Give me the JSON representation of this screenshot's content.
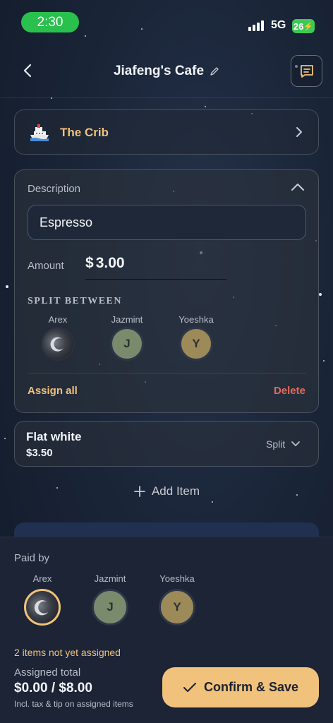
{
  "status_bar": {
    "time": "2:30",
    "network": "5G",
    "battery": "26"
  },
  "header": {
    "title": "Jiafeng's Cafe"
  },
  "group": {
    "name": "The Crib",
    "icon": "ship-icon"
  },
  "item_editor": {
    "description_label": "Description",
    "description_value": "Espresso",
    "amount_label": "Amount",
    "amount_currency": "$",
    "amount_value": "3.00",
    "split_label": "SPLIT BETWEEN",
    "members": [
      {
        "name": "Arex",
        "initial": ""
      },
      {
        "name": "Jazmint",
        "initial": "J"
      },
      {
        "name": "Yoeshka",
        "initial": "Y"
      }
    ],
    "assign_all_label": "Assign all",
    "delete_label": "Delete"
  },
  "items": [
    {
      "name": "Flat white",
      "price": "$3.50",
      "split_label": "Split"
    }
  ],
  "add_item_label": "Add Item",
  "footer": {
    "paid_by_label": "Paid by",
    "payers": [
      {
        "name": "Arex",
        "initial": "",
        "selected": true
      },
      {
        "name": "Jazmint",
        "initial": "J",
        "selected": false
      },
      {
        "name": "Yoeshka",
        "initial": "Y",
        "selected": false
      }
    ],
    "unassigned_text": "2 items not yet assigned",
    "assigned_label": "Assigned total",
    "assigned_total": "$0.00 / $8.00",
    "assigned_note": "Incl. tax & tip on assigned items",
    "confirm_label": "Confirm & Save"
  },
  "colors": {
    "accent": "#f0c27c",
    "danger": "#e26b59",
    "background": "#1a2538",
    "status_green": "#2ac04e"
  }
}
